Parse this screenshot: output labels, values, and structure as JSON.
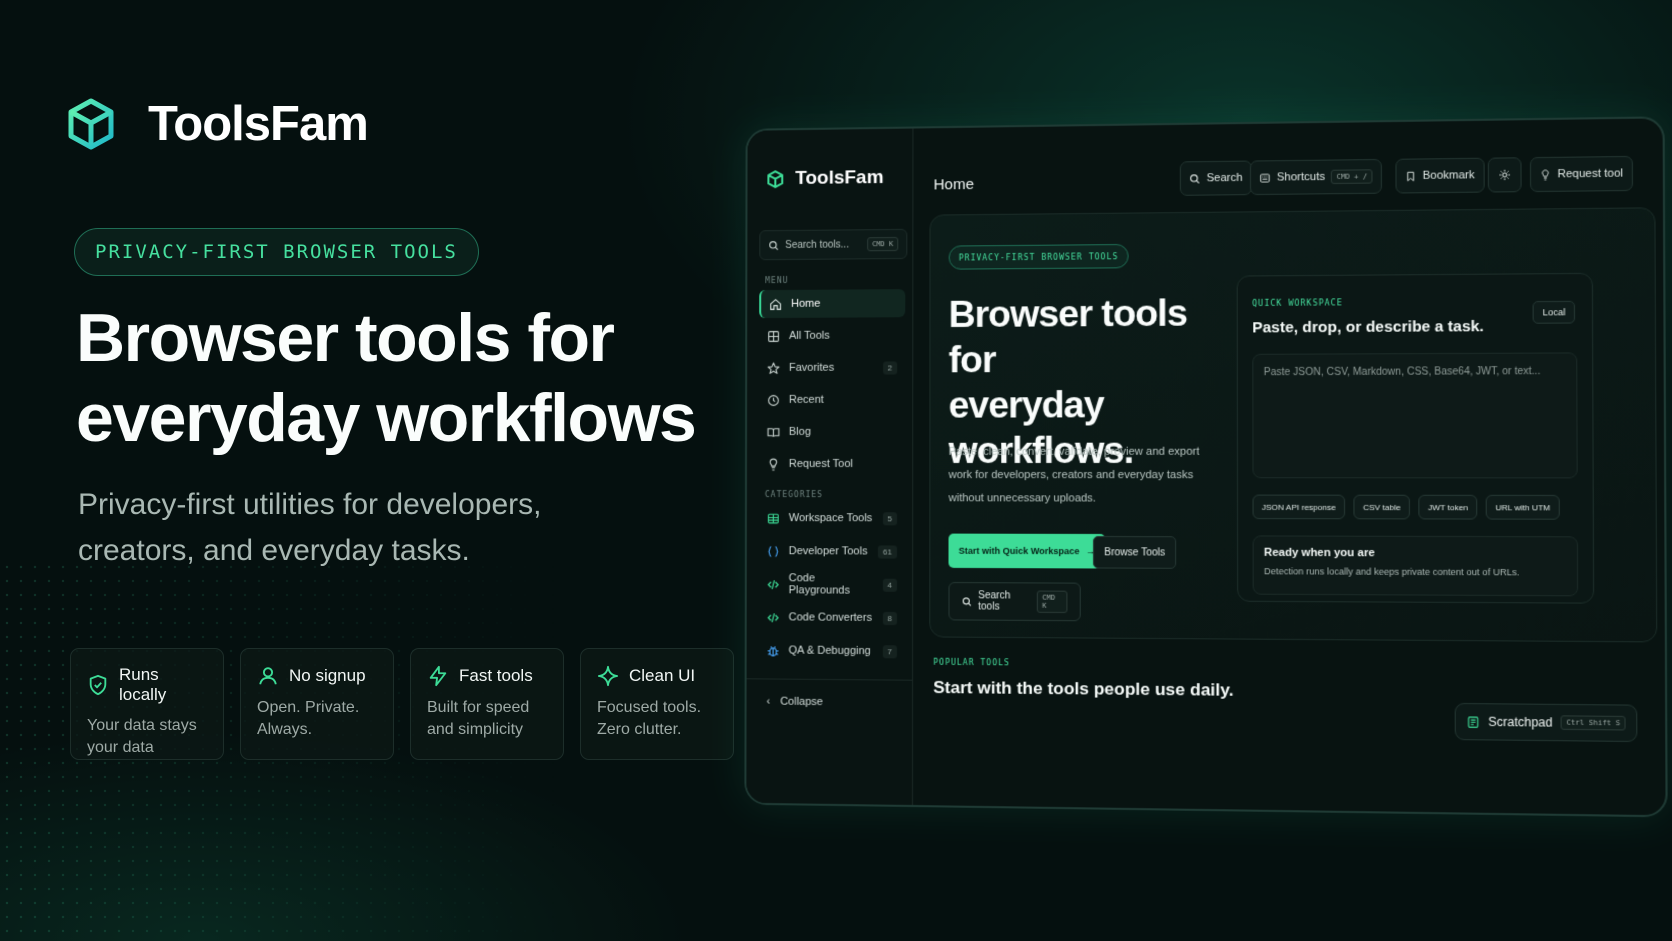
{
  "brand": {
    "name": "ToolsFam"
  },
  "hero": {
    "pill": "PRIVACY-FIRST BROWSER TOOLS",
    "headline_line1": "Browser tools for",
    "headline_line2": "everyday workflows",
    "subtitle_line1": "Privacy-first utilities for developers,",
    "subtitle_line2": "creators, and everyday tasks."
  },
  "features": [
    {
      "icon": "shield-check-icon",
      "title": "Runs locally",
      "desc_line1": "Your data stays",
      "desc_line2": "your data"
    },
    {
      "icon": "user-icon",
      "title": "No signup",
      "desc_line1": "Open. Private.",
      "desc_line2": "Always."
    },
    {
      "icon": "bolt-icon",
      "title": "Fast tools",
      "desc_line1": "Built for speed",
      "desc_line2": "and simplicity"
    },
    {
      "icon": "sparkle-icon",
      "title": "Clean UI",
      "desc_line1": "Focused tools.",
      "desc_line2": "Zero clutter."
    }
  ],
  "app": {
    "sidebar": {
      "brand": "ToolsFam",
      "search_placeholder": "Search tools...",
      "search_kbd": "CMD K",
      "menu_label": "MENU",
      "menu": [
        {
          "label": "Home",
          "icon": "home-icon"
        },
        {
          "label": "All Tools",
          "icon": "grid-icon"
        },
        {
          "label": "Favorites",
          "icon": "star-icon",
          "count": "2"
        },
        {
          "label": "Recent",
          "icon": "clock-icon"
        },
        {
          "label": "Blog",
          "icon": "book-icon"
        },
        {
          "label": "Request Tool",
          "icon": "lightbulb-icon"
        }
      ],
      "categories_label": "CATEGORIES",
      "categories": [
        {
          "label": "Workspace Tools",
          "icon": "table-icon",
          "count": "5"
        },
        {
          "label": "Developer Tools",
          "icon": "braces-icon",
          "count": "61"
        },
        {
          "label": "Code Playgrounds",
          "icon": "code-icon",
          "count": "4"
        },
        {
          "label": "Code Converters",
          "icon": "code-icon",
          "count": "8"
        },
        {
          "label": "QA & Debugging",
          "icon": "bug-icon",
          "count": "7"
        }
      ],
      "collapse": "Collapse"
    },
    "topbar": {
      "title": "Home",
      "search": "Search",
      "shortcuts": "Shortcuts",
      "shortcuts_kbd": "CMD + /",
      "bookmark": "Bookmark",
      "request": "Request tool"
    },
    "hero": {
      "pill": "PRIVACY-FIRST BROWSER TOOLS",
      "headline_line1": "Browser tools for",
      "headline_line2": "everyday",
      "headline_line3": "workflows.",
      "desc_line1": "Paste, clean, convert, validate, preview and export",
      "desc_line2": "work for developers, creators and everyday tasks",
      "desc_line3": "without unnecessary uploads.",
      "primary_btn": "Start with Quick Workspace",
      "secondary_btn": "Browse Tools",
      "search_btn": "Search tools",
      "search_kbd": "CMD K"
    },
    "workspace": {
      "label": "QUICK WORKSPACE",
      "title": "Paste, drop, or describe a task.",
      "badge": "Local",
      "placeholder": "Paste JSON, CSV, Markdown, CSS, Base64, JWT, or text...",
      "chips": [
        "JSON API response",
        "CSV table",
        "JWT token",
        "URL with UTM"
      ],
      "ready_title": "Ready when you are",
      "ready_desc": "Detection runs locally and keeps private content out of URLs."
    },
    "popular": {
      "label": "POPULAR TOOLS",
      "title": "Start with the tools people use daily."
    },
    "scratchpad": {
      "label": "Scratchpad",
      "kbd": "Ctrl Shift S"
    }
  },
  "colors": {
    "accent": "#3ddc97",
    "background": "#05100f",
    "panel": "#0c1c19"
  }
}
